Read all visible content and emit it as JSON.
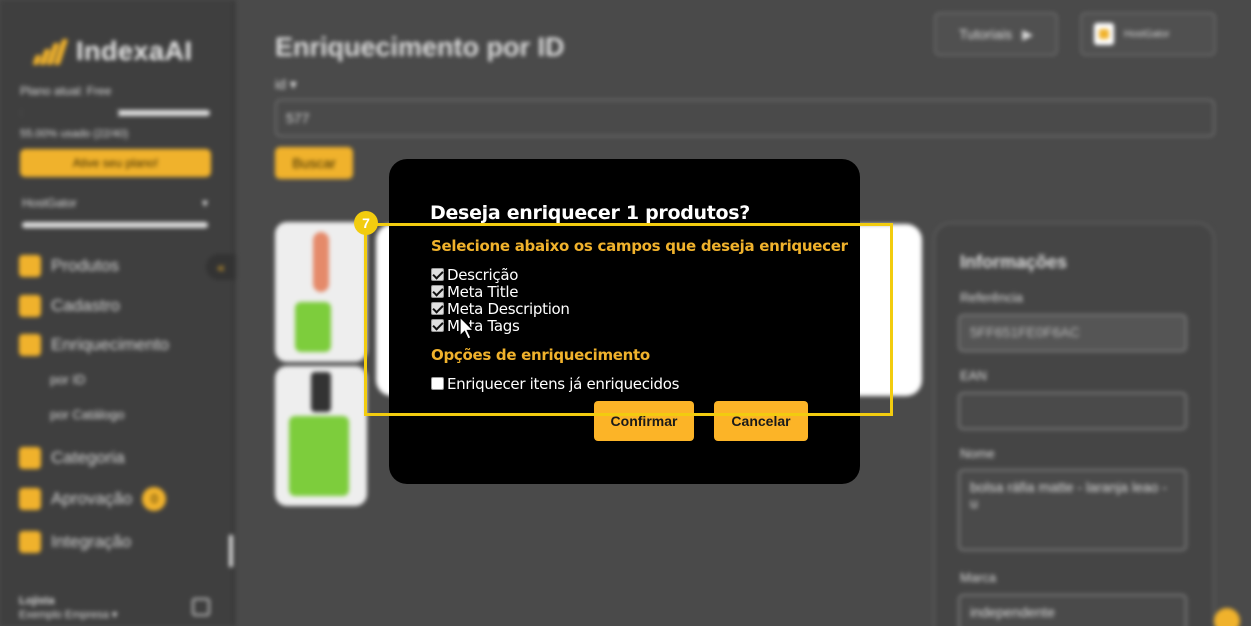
{
  "sidebar": {
    "brand": "IndexaAI",
    "plan": "Plano atual: Free",
    "usage": "55.00% usado (22/40)",
    "usage_fraction": 0.55,
    "activate_label": "Ative seu plano!",
    "store": "HostGator",
    "items": [
      {
        "label": "Produtos"
      },
      {
        "label": "Cadastro"
      },
      {
        "label": "Enriquecimento"
      },
      {
        "label": "Categoria"
      },
      {
        "label": "Aprovação",
        "badge": "0"
      },
      {
        "label": "Integração"
      }
    ],
    "sub_items": [
      "por ID",
      "por Catálogo"
    ],
    "user_name": "Lojista",
    "company": "Exemplo Empresa ▾"
  },
  "header": {
    "title": "Enriquecimento por ID",
    "tutorials_label": "Tutoriais",
    "store_chip": "HostGator"
  },
  "search": {
    "field_label": "id ▾",
    "value": "577",
    "button_label": "Buscar"
  },
  "info": {
    "title": "Informações",
    "reference_label": "Referência",
    "reference_value": "5FF651FE0F6AC",
    "ean_label": "EAN",
    "ean_value": "",
    "name_label": "Nome",
    "name_value": "bolsa ráfia matte - laranja leao - u",
    "brand_label": "Marca",
    "brand_value": "independente"
  },
  "modal": {
    "title": "Deseja enriquecer 1 produtos?",
    "subtitle": "Selecione abaixo os campos que deseja enriquecer",
    "fields": [
      {
        "label": "Descrição",
        "checked": true
      },
      {
        "label": "Meta Title",
        "checked": true
      },
      {
        "label": "Meta Description",
        "checked": true
      },
      {
        "label": "Meta Tags",
        "checked": true
      }
    ],
    "options_title": "Opções de enriquecimento",
    "option_reenrich": {
      "label": "Enriquecer itens já enriquecidos",
      "checked": false
    },
    "confirm_label": "Confirmar",
    "cancel_label": "Cancelar"
  },
  "tutorial": {
    "step": "7",
    "highlight_color": "#f2cc0f"
  },
  "colors": {
    "accent": "#fcb427",
    "modal_bg": "#000000"
  }
}
